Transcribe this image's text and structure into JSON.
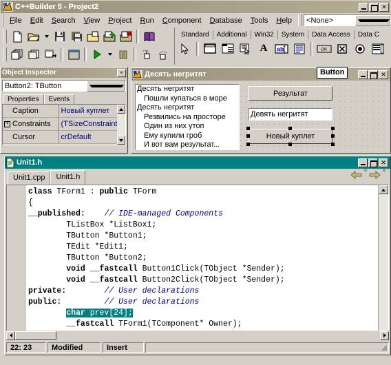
{
  "ide": {
    "title": "C++Builder 5 - Project2",
    "app_icon": "cbuilder-icon",
    "window_buttons": [
      "minimize",
      "maximize",
      "close"
    ],
    "menu": [
      {
        "label": "File",
        "accel": "F"
      },
      {
        "label": "Edit",
        "accel": "E"
      },
      {
        "label": "Search",
        "accel": "S"
      },
      {
        "label": "View",
        "accel": "V"
      },
      {
        "label": "Project",
        "accel": "P"
      },
      {
        "label": "Run",
        "accel": "R"
      },
      {
        "label": "Component",
        "accel": "C"
      },
      {
        "label": "Database",
        "accel": "D"
      },
      {
        "label": "Tools",
        "accel": "T"
      },
      {
        "label": "Help",
        "accel": "H"
      }
    ],
    "desktop_combo": {
      "value": "<None>"
    }
  },
  "toolbar": {
    "row1": [
      "new-file-icon",
      "open-file-icon",
      "open-dropdown-icon",
      "save-icon",
      "save-all-icon",
      "open-project-icon",
      "add-to-project-icon",
      "remove-from-project-icon",
      "help-book-icon"
    ],
    "row2": [
      "view-unit-icon",
      "view-form-icon",
      "toggle-form-unit-icon",
      "new-form-icon",
      "run-icon",
      "run-dropdown-icon",
      "pause-icon",
      "trace-into-icon",
      "step-over-icon"
    ]
  },
  "palette": {
    "tabs": [
      "Standard",
      "Additional",
      "Win32",
      "System",
      "Data Access",
      "Data C"
    ],
    "active_tab": "Standard",
    "components": [
      "pointer-arrow-icon",
      "frames-icon",
      "mainmenu-icon",
      "popupmenu-icon",
      "label-icon",
      "edit-icon",
      "memo-icon",
      "button-icon",
      "checkbox-icon",
      "radiobutton-icon",
      "listbox-icon"
    ]
  },
  "object_inspector": {
    "title": "Object Inspector",
    "close_label": "×",
    "selector": "Button2: TButton",
    "tabs": [
      {
        "label": "Properties",
        "active": true
      },
      {
        "label": "Events",
        "active": false
      }
    ],
    "rows": [
      {
        "name": "Caption",
        "value": "Новый куплет",
        "expandable": false
      },
      {
        "name": "Constraints",
        "value": "(TSizeConstraint",
        "expandable": true
      },
      {
        "name": "Cursor",
        "value": "crDefault",
        "expandable": false
      }
    ]
  },
  "form_designer": {
    "title": "Десять негритят",
    "icon": "form-icon",
    "window_buttons": [
      "minimize",
      "maximize",
      "close"
    ],
    "tooltip": "Button",
    "listbox": {
      "name": "ListBox1",
      "items": [
        {
          "text": "Десять негритят",
          "indent": false
        },
        {
          "text": "Пошли купаться в море",
          "indent": true
        },
        {
          "text": "Десять негритят",
          "indent": false
        },
        {
          "text": "Резвились на просторе",
          "indent": true
        },
        {
          "text": "Один из них утоп",
          "indent": true
        },
        {
          "text": "Ему купили гроб",
          "indent": true
        },
        {
          "text": "И вот вам результат...",
          "indent": true
        }
      ]
    },
    "button1": {
      "caption": "Результат"
    },
    "edit1": {
      "value": "Девять негритят"
    },
    "button2": {
      "caption": "Новый куплет",
      "selected": true
    }
  },
  "editor": {
    "title": "Unit1.h",
    "icon": "source-file-icon",
    "window_buttons": [
      "minimize",
      "maximize",
      "close"
    ],
    "tabs": [
      {
        "label": "Unit1.cpp",
        "active": false
      },
      {
        "label": "Unit1.h",
        "active": true
      }
    ],
    "nav": [
      "back-arrow-icon",
      "back-dropdown-icon",
      "forward-arrow-icon",
      "forward-dropdown-icon"
    ],
    "code_lines": [
      [
        {
          "t": "class ",
          "s": "kw"
        },
        {
          "t": "TForm1 : ",
          "s": ""
        },
        {
          "t": "public ",
          "s": "kw"
        },
        {
          "t": "TForm",
          "s": ""
        }
      ],
      [
        {
          "t": "{",
          "s": ""
        }
      ],
      [
        {
          "t": "__published:",
          "s": "kw"
        },
        {
          "t": "    ",
          "s": ""
        },
        {
          "t": "// IDE-managed Components",
          "s": "cm"
        }
      ],
      [
        {
          "t": "        TListBox *ListBox1;",
          "s": ""
        }
      ],
      [
        {
          "t": "        TButton *Button1;",
          "s": ""
        }
      ],
      [
        {
          "t": "        TEdit *Edit1;",
          "s": ""
        }
      ],
      [
        {
          "t": "        TButton *Button2;",
          "s": ""
        }
      ],
      [
        {
          "t": "        ",
          "s": ""
        },
        {
          "t": "void ",
          "s": "kw"
        },
        {
          "t": "__fastcall",
          "s": "kw"
        },
        {
          "t": " Button1Click(TObject *Sender);",
          "s": ""
        }
      ],
      [
        {
          "t": "        ",
          "s": ""
        },
        {
          "t": "void ",
          "s": "kw"
        },
        {
          "t": "__fastcall",
          "s": "kw"
        },
        {
          "t": " Button2Click(TObject *Sender);",
          "s": ""
        }
      ],
      [
        {
          "t": "private:",
          "s": "kw"
        },
        {
          "t": "        ",
          "s": ""
        },
        {
          "t": "// User declarations",
          "s": "cm"
        }
      ],
      [
        {
          "t": "public:",
          "s": "kw"
        },
        {
          "t": "         ",
          "s": ""
        },
        {
          "t": "// User declarations",
          "s": "cm"
        }
      ],
      [
        {
          "t": "        ",
          "s": ""
        },
        {
          "t": "char ",
          "s": "kw sel"
        },
        {
          "t": "prev[24];",
          "s": "sel"
        }
      ],
      [
        {
          "t": "        ",
          "s": ""
        },
        {
          "t": "__fastcall",
          "s": "kw"
        },
        {
          "t": " TForm1(TComponent* Owner);",
          "s": ""
        }
      ]
    ],
    "status": {
      "position": "22:  23",
      "modified": "Modified",
      "mode": "Insert"
    }
  },
  "colors": {
    "desktop": "#d4d0c8",
    "title_active": "#9a917c",
    "editor_title": "#008080",
    "selection": "#008080",
    "comment": "#000080",
    "oi_value": "#000080"
  }
}
